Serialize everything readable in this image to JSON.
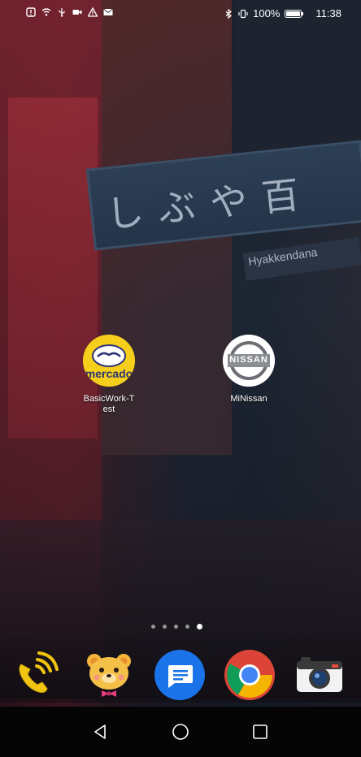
{
  "status_bar": {
    "battery": "100%",
    "time": "11:38",
    "left_icons": [
      "notification-icon",
      "wifi-icon",
      "usb-icon",
      "video-icon",
      "warning-icon",
      "mail-icon"
    ],
    "right_icons": [
      "bluetooth-icon",
      "vibrate-icon",
      "battery-icon"
    ]
  },
  "wallpaper": {
    "sign_text": "しぶや百",
    "sub_sign_text": "Hyakkendana"
  },
  "home_apps": [
    {
      "label": "BasicWork-Test",
      "icon": "mercado-icon",
      "icon_text": "mercado"
    },
    {
      "label": "MiNissan",
      "icon": "nissan-icon",
      "icon_text": "NISSAN"
    }
  ],
  "page_indicator": {
    "count": 5,
    "active": 5
  },
  "dock": [
    {
      "name": "phone-icon"
    },
    {
      "name": "bear-icon"
    },
    {
      "name": "messages-icon"
    },
    {
      "name": "chrome-icon"
    },
    {
      "name": "camera-icon"
    }
  ],
  "nav": [
    "back-icon",
    "home-icon",
    "recents-icon"
  ],
  "colors": {
    "mercado_yellow": "#f5cf1c",
    "messages_blue": "#1a73e8",
    "chrome_red": "#db4437",
    "chrome_green": "#0f9d58",
    "chrome_yellow": "#f4b400"
  }
}
